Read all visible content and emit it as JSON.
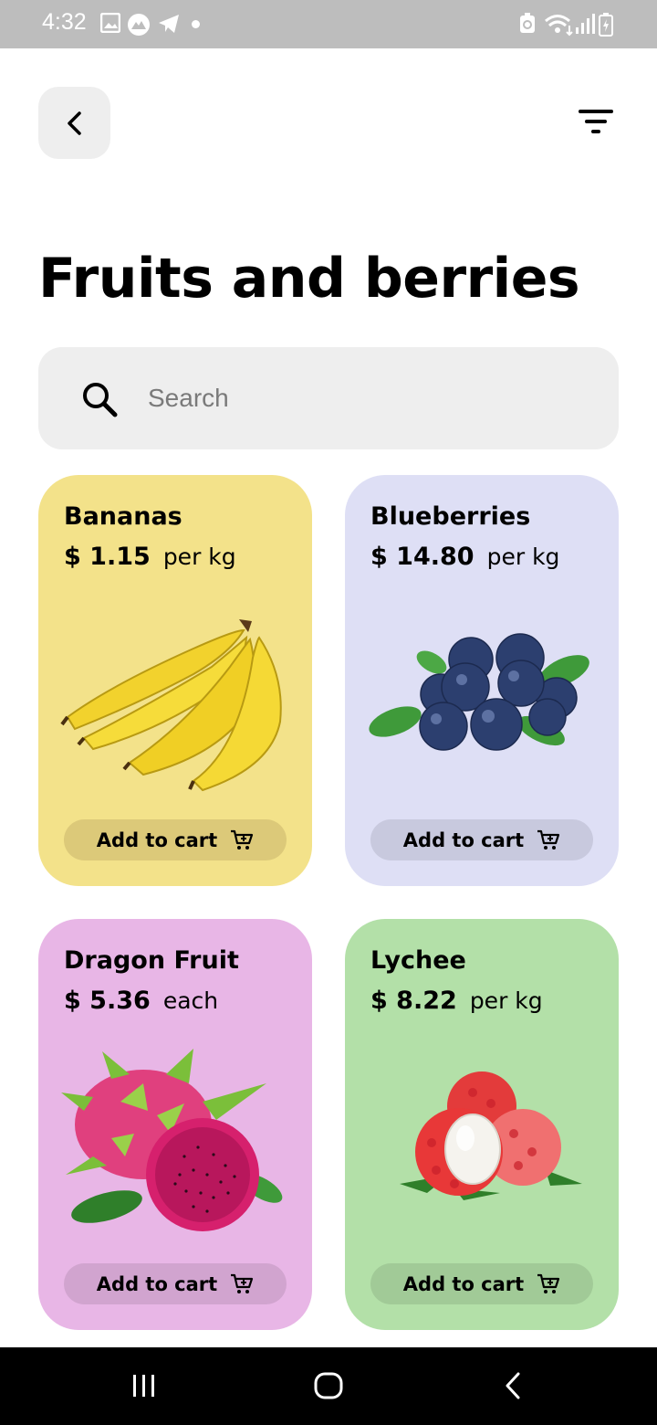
{
  "status_bar": {
    "time": "4:32"
  },
  "header": {
    "title": "Fruits and berries"
  },
  "search": {
    "placeholder": "Search"
  },
  "products": [
    {
      "name": "Bananas",
      "price": "$ 1.15",
      "unit": "per kg",
      "button_label": "Add to cart",
      "card_color": "#f3e28a",
      "button_color": "#dcc979"
    },
    {
      "name": "Blueberries",
      "price": "$ 14.80",
      "unit": "per kg",
      "button_label": "Add to cart",
      "card_color": "#dedff5",
      "button_color": "#c8c9de"
    },
    {
      "name": "Dragon Fruit",
      "price": "$ 5.36",
      "unit": "each",
      "button_label": "Add to cart",
      "card_color": "#e8b6e6",
      "button_color": "#d1a4cf"
    },
    {
      "name": "Lychee",
      "price": "$ 8.22",
      "unit": "per kg",
      "button_label": "Add to cart",
      "card_color": "#b3e0a8",
      "button_color": "#a1ca97"
    }
  ],
  "icons": [
    "back-chevron-icon",
    "filter-icon",
    "search-icon",
    "cart-icon",
    "recent-apps-icon",
    "home-icon",
    "nav-back-icon"
  ]
}
